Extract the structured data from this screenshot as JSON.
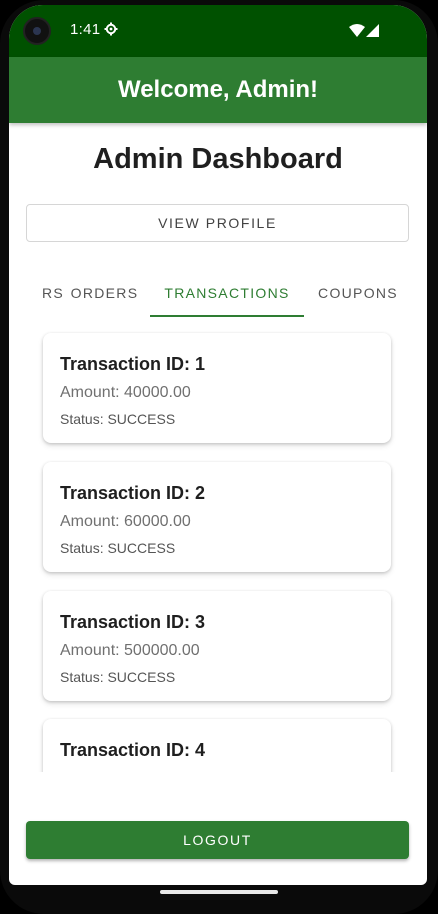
{
  "status_bar": {
    "time": "1:41",
    "icons": [
      "gear-icon",
      "wifi-icon",
      "cell-signal-icon"
    ]
  },
  "app_bar": {
    "title": "Welcome, Admin!"
  },
  "dashboard": {
    "title": "Admin Dashboard",
    "view_profile_label": "VIEW PROFILE"
  },
  "tabs": [
    {
      "label": "RS",
      "active": false
    },
    {
      "label": "ORDERS",
      "active": false
    },
    {
      "label": "TRANSACTIONS",
      "active": true
    },
    {
      "label": "COUPONS",
      "active": false
    }
  ],
  "transactions": [
    {
      "title": "Transaction ID: 1",
      "amount": "Amount: 40000.00",
      "status": "Status: SUCCESS"
    },
    {
      "title": "Transaction ID: 2",
      "amount": "Amount: 60000.00",
      "status": "Status: SUCCESS"
    },
    {
      "title": "Transaction ID: 3",
      "amount": "Amount: 500000.00",
      "status": "Status: SUCCESS"
    },
    {
      "title": "Transaction ID: 4",
      "amount": "",
      "status": ""
    }
  ],
  "logout_label": "LOGOUT",
  "colors": {
    "status_bar": "#005100",
    "primary": "#2e7d32"
  }
}
